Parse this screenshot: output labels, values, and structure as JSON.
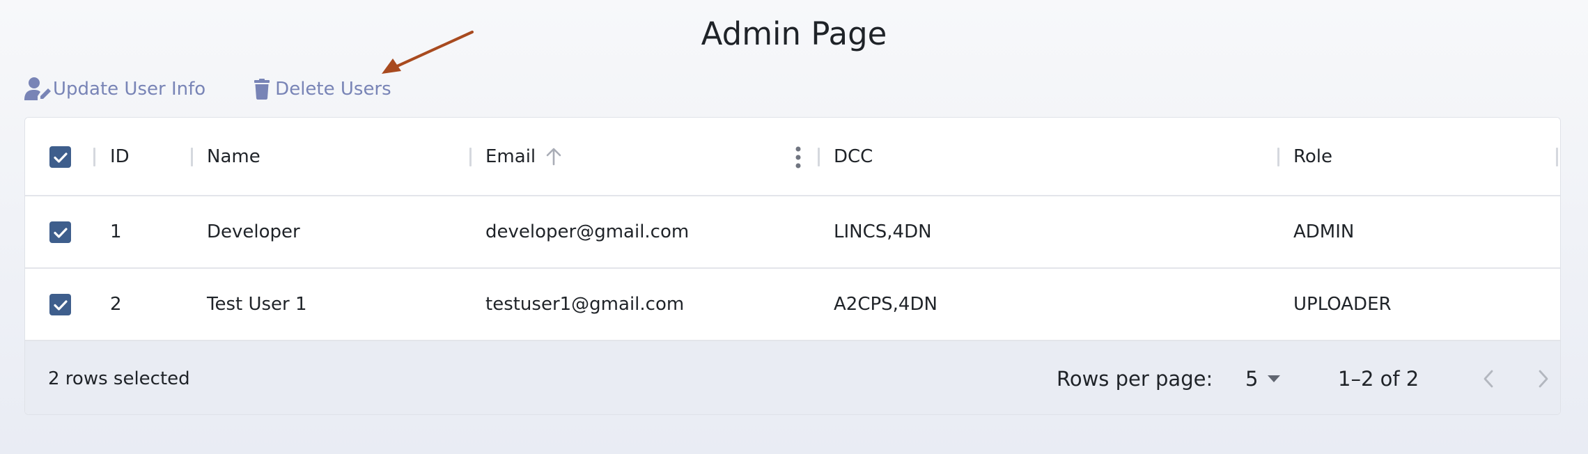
{
  "page": {
    "title": "Admin Page"
  },
  "toolbar": {
    "update_label": "Update User Info",
    "delete_label": "Delete Users"
  },
  "table": {
    "columns": [
      "ID",
      "Name",
      "Email",
      "DCC",
      "Role"
    ],
    "sorted_column": "Email",
    "sort_direction": "ascending",
    "rows": [
      {
        "id": "1",
        "name": "Developer",
        "email": "developer@gmail.com",
        "dcc": "LINCS,4DN",
        "role": "ADMIN",
        "selected": true
      },
      {
        "id": "2",
        "name": "Test User 1",
        "email": "testuser1@gmail.com",
        "dcc": "A2CPS,4DN",
        "role": "UPLOADER",
        "selected": true
      }
    ]
  },
  "footer": {
    "selected_text": "2 rows selected",
    "rows_per_page_label": "Rows per page:",
    "rows_per_page_value": "5",
    "range_text": "1–2 of 2"
  },
  "colors": {
    "accent": "#3e5e8c",
    "toolbar_text": "#7884b6",
    "annotation_arrow": "#a84a1f"
  },
  "icons": [
    "user-edit-icon",
    "trash-icon",
    "checkbox-checked-icon",
    "sort-arrow-up-icon",
    "column-menu-icon",
    "dropdown-arrow-icon",
    "chevron-left-icon",
    "chevron-right-icon"
  ]
}
